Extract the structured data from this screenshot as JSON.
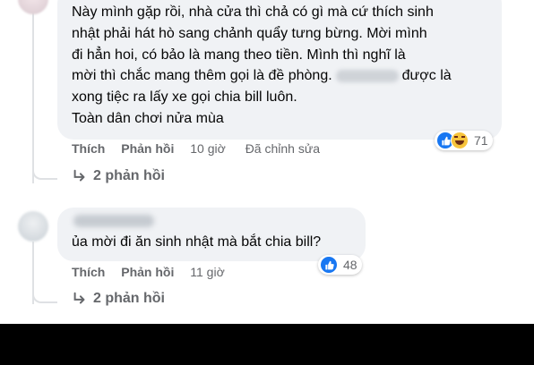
{
  "comment1": {
    "lines": [
      "Này mình gặp rồi, nhà cửa thì chả có gì mà cứ thích sinh",
      "nhật phải hát hò sang chảnh quẩy tưng bừng. Mời mình",
      "đi hẳn hoi, có bảo là mang theo tiền. Mình thì nghĩ là",
      "mời thì chắc mang thêm gọi là đề phòng.",
      "được là",
      "xong tiệc ra lấy xe gọi chia bill luôn.",
      "Toàn dân chơi nửa mùa"
    ],
    "actions": {
      "like": "Thích",
      "reply": "Phản hồi",
      "time": "10 giờ",
      "edited": "Đã chỉnh sửa"
    },
    "reaction_count": "71",
    "reactions": [
      "like-icon",
      "haha-icon"
    ],
    "replies_label": "2 phản hồi"
  },
  "comment2": {
    "text": "ủa mời đi ăn sinh nhật mà bắt chia bill?",
    "actions": {
      "like": "Thích",
      "reply": "Phản hồi",
      "time": "11 giờ"
    },
    "reaction_count": "48",
    "reactions": [
      "like-icon"
    ],
    "replies_label": "2 phản hồi"
  },
  "colors": {
    "bubble": "#f0f2f5",
    "secondary_text": "#65676b",
    "like_blue": "#1877f2",
    "haha_yellow": "#f7c43c"
  }
}
